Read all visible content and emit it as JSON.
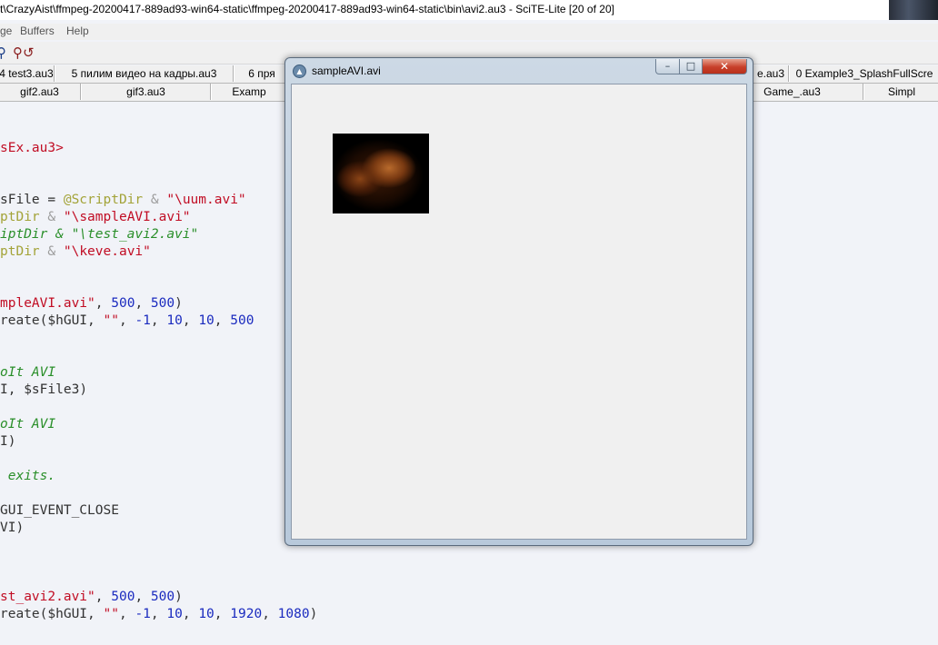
{
  "window": {
    "title": "t\\CrazyAist\\ffmpeg-20200417-889ad93-win64-static\\ffmpeg-20200417-889ad93-win64-static\\bin\\avi2.au3 - SciTE-Lite [20 of 20]"
  },
  "menu": {
    "items": [
      "ge",
      "Buffers",
      "Help"
    ]
  },
  "toolbar": {
    "icons": [
      "find-icon",
      "replace-icon"
    ]
  },
  "tabs_row1": [
    "4 test3.au3",
    "5 пилим видео на кадры.au3",
    "6 пря",
    "e.au3",
    "0 Example3_SplashFullScre"
  ],
  "tabs_row2": [
    "gif2.au3",
    "gif3.au3",
    "Examp",
    "Game_.au3",
    "Simpl"
  ],
  "code": [
    {
      "segs": [
        {
          "t": "sEx.au3>",
          "c": "str"
        }
      ]
    },
    {
      "segs": [
        {
          "t": "sFile = ",
          "c": "var"
        },
        {
          "t": "@ScriptDir",
          "c": "macro"
        },
        {
          "t": " & ",
          "c": "op"
        },
        {
          "t": "\"\\uum.avi\"",
          "c": "str"
        }
      ]
    },
    {
      "segs": [
        {
          "t": "ptDir",
          "c": "macro"
        },
        {
          "t": " & ",
          "c": "op"
        },
        {
          "t": "\"\\sampleAVI.avi\"",
          "c": "str"
        }
      ]
    },
    {
      "segs": [
        {
          "t": "iptDir & \"\\test_avi2.avi\"",
          "c": "cmt"
        }
      ]
    },
    {
      "segs": [
        {
          "t": "ptDir",
          "c": "macro"
        },
        {
          "t": " & ",
          "c": "op"
        },
        {
          "t": "\"\\keve.avi\"",
          "c": "str"
        }
      ]
    },
    {
      "segs": [
        {
          "t": "mpleAVI.avi\"",
          "c": "str"
        },
        {
          "t": ", ",
          "c": "plain"
        },
        {
          "t": "500",
          "c": "num"
        },
        {
          "t": ", ",
          "c": "plain"
        },
        {
          "t": "500",
          "c": "num"
        },
        {
          "t": ")",
          "c": "plain"
        }
      ]
    },
    {
      "segs": [
        {
          "t": "reate(",
          "c": "plain"
        },
        {
          "t": "$hGUI",
          "c": "var"
        },
        {
          "t": ", ",
          "c": "plain"
        },
        {
          "t": "\"\"",
          "c": "str"
        },
        {
          "t": ", ",
          "c": "plain"
        },
        {
          "t": "-1",
          "c": "num"
        },
        {
          "t": ", ",
          "c": "plain"
        },
        {
          "t": "10",
          "c": "num"
        },
        {
          "t": ", ",
          "c": "plain"
        },
        {
          "t": "10",
          "c": "num"
        },
        {
          "t": ", ",
          "c": "plain"
        },
        {
          "t": "500",
          "c": "num"
        }
      ]
    },
    {
      "segs": [
        {
          "t": "oIt AVI",
          "c": "cmt"
        }
      ]
    },
    {
      "segs": [
        {
          "t": "I, ",
          "c": "plain"
        },
        {
          "t": "$sFile3",
          "c": "var"
        },
        {
          "t": ")",
          "c": "plain"
        }
      ]
    },
    {
      "segs": [
        {
          "t": "oIt AVI",
          "c": "cmt"
        }
      ]
    },
    {
      "segs": [
        {
          "t": "I)",
          "c": "plain"
        }
      ]
    },
    {
      "segs": [
        {
          "t": " exits.",
          "c": "cmt"
        }
      ]
    },
    {
      "segs": [
        {
          "t": "GUI_EVENT_CLOSE",
          "c": "plain"
        }
      ]
    },
    {
      "segs": [
        {
          "t": "VI)",
          "c": "plain"
        }
      ]
    },
    {
      "segs": [
        {
          "t": "st_avi2.avi\"",
          "c": "str"
        },
        {
          "t": ", ",
          "c": "plain"
        },
        {
          "t": "500",
          "c": "num"
        },
        {
          "t": ", ",
          "c": "plain"
        },
        {
          "t": "500",
          "c": "num"
        },
        {
          "t": ")",
          "c": "plain"
        }
      ]
    },
    {
      "segs": [
        {
          "t": "reate(",
          "c": "plain"
        },
        {
          "t": "$hGUI",
          "c": "var"
        },
        {
          "t": ", ",
          "c": "plain"
        },
        {
          "t": "\"\"",
          "c": "str"
        },
        {
          "t": ", ",
          "c": "plain"
        },
        {
          "t": "-1",
          "c": "num"
        },
        {
          "t": ", ",
          "c": "plain"
        },
        {
          "t": "10",
          "c": "num"
        },
        {
          "t": ", ",
          "c": "plain"
        },
        {
          "t": "10",
          "c": "num"
        },
        {
          "t": ", ",
          "c": "plain"
        },
        {
          "t": "1920",
          "c": "num"
        },
        {
          "t": ", ",
          "c": "plain"
        },
        {
          "t": "1080",
          "c": "num"
        },
        {
          "t": ")",
          "c": "plain"
        }
      ]
    }
  ],
  "dialog": {
    "title": "sampleAVI.avi",
    "minimize_glyph": "–",
    "maximize_glyph": "□",
    "close_glyph": "✕"
  },
  "colors": {
    "string": "#c10d24",
    "number": "#1b2bbf",
    "comment": "#2a8f2a",
    "macro": "#a3a338",
    "editor_bg": "#f1f3f8"
  }
}
